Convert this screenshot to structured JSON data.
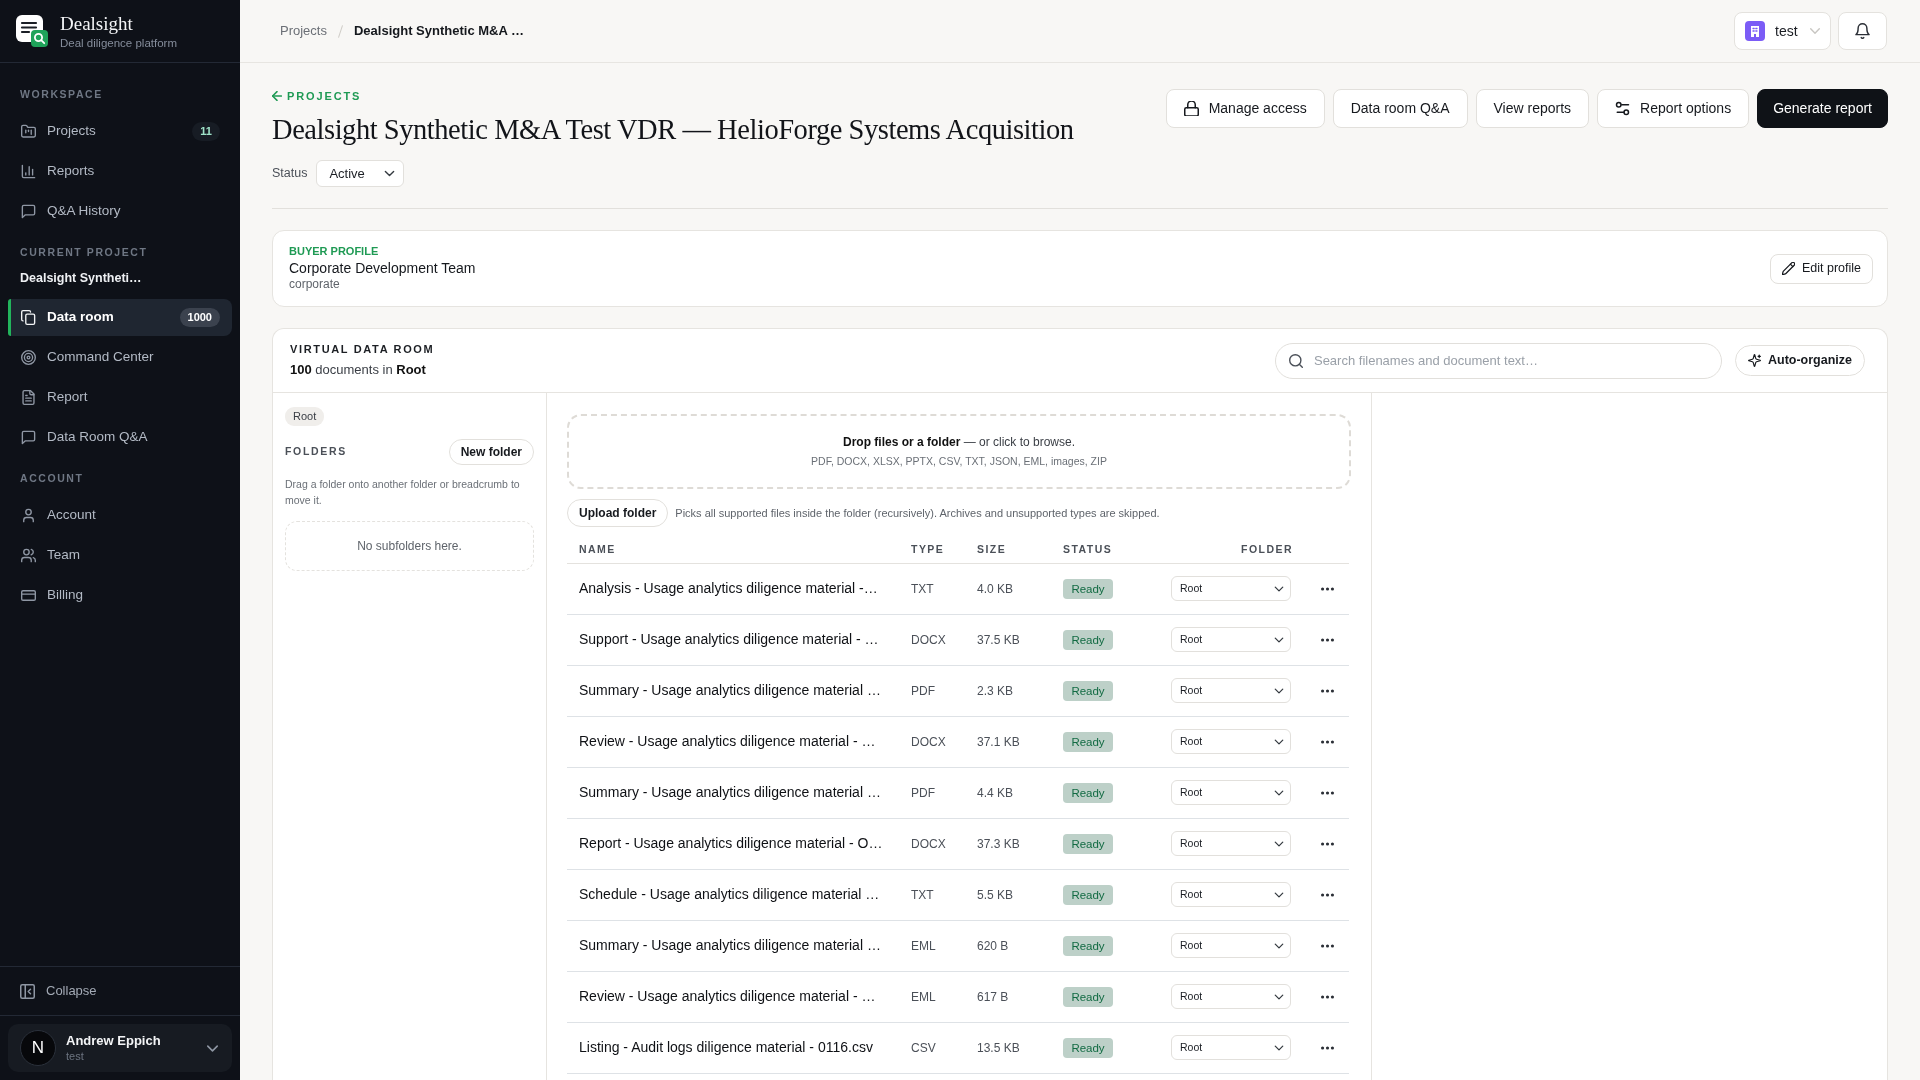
{
  "sidebar": {
    "brand": {
      "name": "Dealsight",
      "tagline": "Deal diligence platform"
    },
    "sections": [
      {
        "heading": "WORKSPACE",
        "items": [
          {
            "label": "Projects",
            "badge": "11",
            "selected": false
          },
          {
            "label": "Reports",
            "selected": false
          },
          {
            "label": "Q&A History",
            "selected": false
          }
        ]
      },
      {
        "heading": "CURRENT PROJECT",
        "project": "Dealsight Syntheti…",
        "items": [
          {
            "label": "Data room",
            "badge": "1000",
            "selected": true
          },
          {
            "label": "Command Center",
            "selected": false
          },
          {
            "label": "Report",
            "selected": false
          },
          {
            "label": "Data Room Q&A",
            "selected": false
          }
        ]
      },
      {
        "heading": "ACCOUNT",
        "items": [
          {
            "label": "Account",
            "selected": false
          },
          {
            "label": "Team",
            "selected": false
          },
          {
            "label": "Billing",
            "selected": false
          }
        ]
      }
    ],
    "collapse": "Collapse",
    "user": {
      "avatar": "N",
      "name": "Andrew Eppich",
      "subtitle": "test"
    }
  },
  "topbar": {
    "breadcrumb": [
      "Projects",
      "Dealsight Synthetic M&A …"
    ],
    "workspace": "test"
  },
  "header": {
    "back_link": "PROJECTS",
    "title": "Dealsight Synthetic M&A Test VDR — HelioForge Systems Acquisition",
    "status": {
      "label": "Status",
      "value": "Active"
    },
    "actions": [
      {
        "label": "Manage access",
        "kind": "secondary"
      },
      {
        "label": "Data room Q&A",
        "kind": "secondary"
      },
      {
        "label": "View reports",
        "kind": "secondary"
      },
      {
        "label": "Report options",
        "kind": "secondary"
      },
      {
        "label": "Generate report",
        "kind": "primary"
      }
    ]
  },
  "buyer_profile": {
    "heading": "BUYER PROFILE",
    "name": "Corporate Development Team",
    "type": "corporate",
    "button": "Edit profile"
  },
  "data_room": {
    "heading": "VIRTUAL DATA ROOM",
    "summary": "**100** documents in **Root**",
    "search": {
      "placeholder": "Search filenames and document text…"
    },
    "auto_organize": "Auto-organize",
    "folders": {
      "breadcrumb": "Root",
      "heading": "FOLDERS",
      "new_folder": "New folder",
      "hint": "Drag a folder onto another folder or breadcrumb to move it.",
      "empty": "No subfolders here."
    },
    "dropzone": {
      "text": "**Drop files or a folder** — or click to browse.",
      "formats": "PDF, DOCX, XLSX, PPTX, CSV, TXT, JSON, EML, images, ZIP"
    },
    "upload": {
      "button": "Upload folder",
      "hint": "Picks all supported files inside the folder (recursively). Archives and unsupported types are skipped."
    },
    "table": {
      "columns": [
        "NAME",
        "TYPE",
        "SIZE",
        "STATUS",
        "FOLDER"
      ],
      "rows": [
        {
          "name": "Analysis - Usage analytics diligence material -…",
          "type": "TXT",
          "size": "4.0 KB",
          "status": "Ready",
          "folder": "Root"
        },
        {
          "name": "Support - Usage analytics diligence material - …",
          "type": "DOCX",
          "size": "37.5 KB",
          "status": "Ready",
          "folder": "Root"
        },
        {
          "name": "Summary - Usage analytics diligence material …",
          "type": "PDF",
          "size": "2.3 KB",
          "status": "Ready",
          "folder": "Root"
        },
        {
          "name": "Review - Usage analytics diligence material - …",
          "type": "DOCX",
          "size": "37.1 KB",
          "status": "Ready",
          "folder": "Root"
        },
        {
          "name": "Summary - Usage analytics diligence material …",
          "type": "PDF",
          "size": "4.4 KB",
          "status": "Ready",
          "folder": "Root"
        },
        {
          "name": "Report - Usage analytics diligence material - O…",
          "type": "DOCX",
          "size": "37.3 KB",
          "status": "Ready",
          "folder": "Root"
        },
        {
          "name": "Schedule - Usage analytics diligence material …",
          "type": "TXT",
          "size": "5.5 KB",
          "status": "Ready",
          "folder": "Root"
        },
        {
          "name": "Summary - Usage analytics diligence material …",
          "type": "EML",
          "size": "620 B",
          "status": "Ready",
          "folder": "Root"
        },
        {
          "name": "Review - Usage analytics diligence material - …",
          "type": "EML",
          "size": "617 B",
          "status": "Ready",
          "folder": "Root"
        },
        {
          "name": "Listing - Audit logs diligence material - 0116.csv",
          "type": "CSV",
          "size": "13.5 KB",
          "status": "Ready",
          "folder": "Root"
        }
      ]
    }
  }
}
